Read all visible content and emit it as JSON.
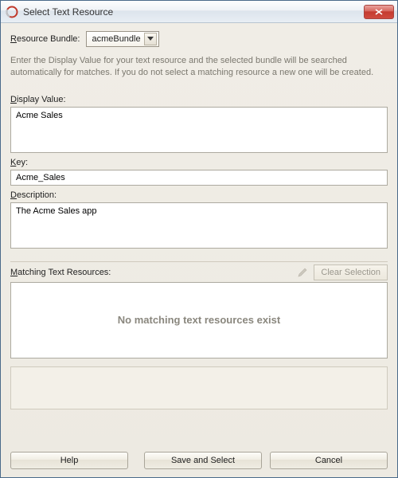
{
  "window": {
    "title": "Select Text Resource"
  },
  "bundle": {
    "label_pre": "R",
    "label_rest": "esource Bundle:",
    "selected": "acmeBundle"
  },
  "help_text": "Enter the Display Value for your text resource and the selected bundle will be searched automatically for matches.  If you do not select a matching resource a new one will be created.",
  "display": {
    "label_pre": "D",
    "label_rest": "isplay Value:",
    "value": "Acme Sales"
  },
  "key": {
    "label_pre": "K",
    "label_rest": "ey:",
    "value": "Acme_Sales"
  },
  "description": {
    "label_pre": "D",
    "label_rest": "escription:",
    "value": "The Acme Sales app"
  },
  "matching": {
    "label_pre": "M",
    "label_rest": "atching Text Resources:",
    "clear_label": "Clear Selection",
    "empty_text": "No matching text resources exist"
  },
  "buttons": {
    "help": "Help",
    "save": "Save and Select",
    "cancel": "Cancel"
  }
}
